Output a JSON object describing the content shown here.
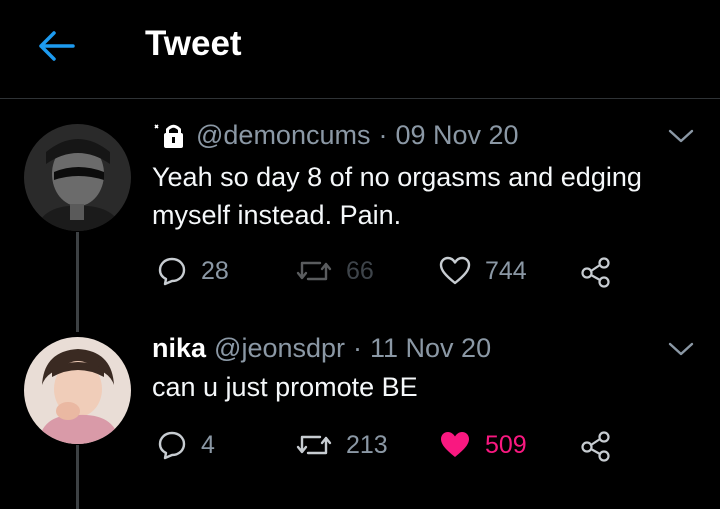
{
  "header": {
    "title": "Tweet"
  },
  "tweets": [
    {
      "name": "",
      "handle": "@demoncums",
      "separator": "·",
      "date": "09 Nov 20",
      "protected": true,
      "text": "Yeah so day 8 of no orgasms and edging myself instead. Pain.",
      "replies": "28",
      "retweets": "66",
      "likes": "744",
      "liked": false
    },
    {
      "name": "nika",
      "handle": "@jeonsdpr",
      "separator": "·",
      "date": "11 Nov 20",
      "protected": false,
      "text": "can u just promote BE",
      "replies": "4",
      "retweets": "213",
      "likes": "509",
      "liked": true
    }
  ],
  "colors": {
    "background": "#000000",
    "accent": "#1d9bf0",
    "like": "#f91880",
    "muted": "#8b98a5"
  },
  "icons": [
    "back-arrow-icon",
    "lock-icon",
    "chevron-down-icon",
    "reply-icon",
    "retweet-icon",
    "heart-icon",
    "share-icon"
  ]
}
